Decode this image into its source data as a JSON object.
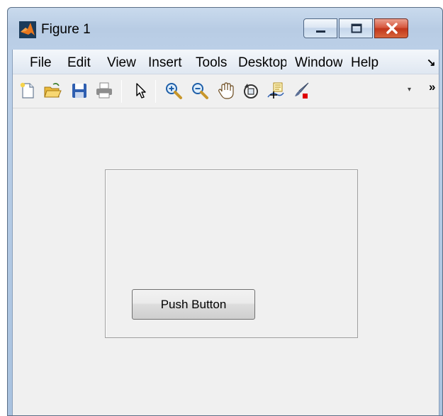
{
  "window": {
    "title": "Figure 1",
    "controls": {
      "minimize": "minimize",
      "maximize": "maximize",
      "close": "close"
    }
  },
  "menubar": {
    "items": [
      "File",
      "Edit",
      "View",
      "Insert",
      "Tools",
      "Desktop",
      "Window",
      "Help"
    ],
    "overflow_icon": "menu-overflow-arrow"
  },
  "toolbar": {
    "icons": [
      "new-figure-icon",
      "open-file-icon",
      "save-icon",
      "print-icon",
      "pointer-icon",
      "zoom-in-icon",
      "zoom-out-icon",
      "pan-hand-icon",
      "rotate-3d-icon",
      "data-cursor-icon",
      "brush-icon"
    ],
    "dropdown_glyph": "▾",
    "more_glyph": "»"
  },
  "figure": {
    "push_button_label": "Push Button"
  },
  "colors": {
    "title_bar": "#b8cce4",
    "client_bg": "#f0f0f0",
    "close_button": "#c1361b"
  }
}
